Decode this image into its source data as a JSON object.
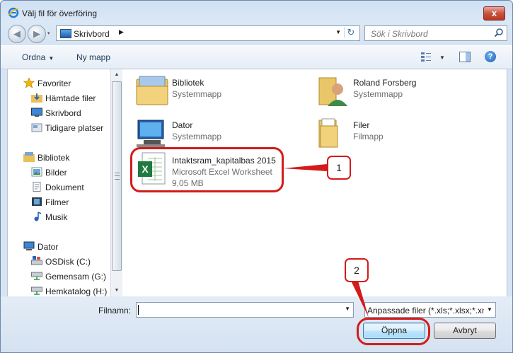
{
  "window": {
    "title": "Välj fil för överföring",
    "close_label": "x"
  },
  "nav": {
    "back_glyph": "◀",
    "forward_glyph": "▶",
    "dropdown_glyph": "▾",
    "address": {
      "location": "Skrivbord",
      "sep": "▶",
      "drop": "▼",
      "refresh": "↻"
    },
    "search_placeholder": "Sök i Skrivbord"
  },
  "toolbar": {
    "organize": "Ordna",
    "organize_arrow": "▼",
    "new_folder": "Ny mapp",
    "view_drop": "▼",
    "help": "?"
  },
  "sidebar": {
    "favorites": {
      "title": "Favoriter",
      "items": [
        "Hämtade filer",
        "Skrivbord",
        "Tidigare platser"
      ]
    },
    "libraries": {
      "title": "Bibliotek",
      "items": [
        "Bilder",
        "Dokument",
        "Filmer",
        "Musik"
      ]
    },
    "computer": {
      "title": "Dator",
      "items": [
        "OSDisk (C:)",
        "Gemensam (G:)",
        "Hemkatalog (H:)"
      ]
    }
  },
  "scrollbar": {
    "up": "▲",
    "down": "▼"
  },
  "files": [
    {
      "name": "Bibliotek",
      "type": "Systemmapp",
      "icon": "library-folder"
    },
    {
      "name": "Roland Forsberg",
      "type": "Systemmapp",
      "icon": "user-folder"
    },
    {
      "name": "Dator",
      "type": "Systemmapp",
      "icon": "computer"
    },
    {
      "name": "Filer",
      "type": "Filmapp",
      "icon": "folder"
    },
    {
      "name": "Intaktsram_kapitalbas 2015",
      "type": "Microsoft Excel Worksheet",
      "size": "9,05 MB",
      "icon": "excel-file"
    }
  ],
  "bottom": {
    "filename_label": "Filnamn:",
    "filename_value": "",
    "filename_drop": "▼",
    "filter": "Anpassade filer (*.xls;*.xlsx;*.xm",
    "filter_drop": "▼",
    "open": "Öppna",
    "cancel": "Avbryt"
  },
  "annotations": {
    "one": "1",
    "two": "2"
  },
  "colors": {
    "annotation": "#d31b1b",
    "accent": "#3c7fb1"
  }
}
